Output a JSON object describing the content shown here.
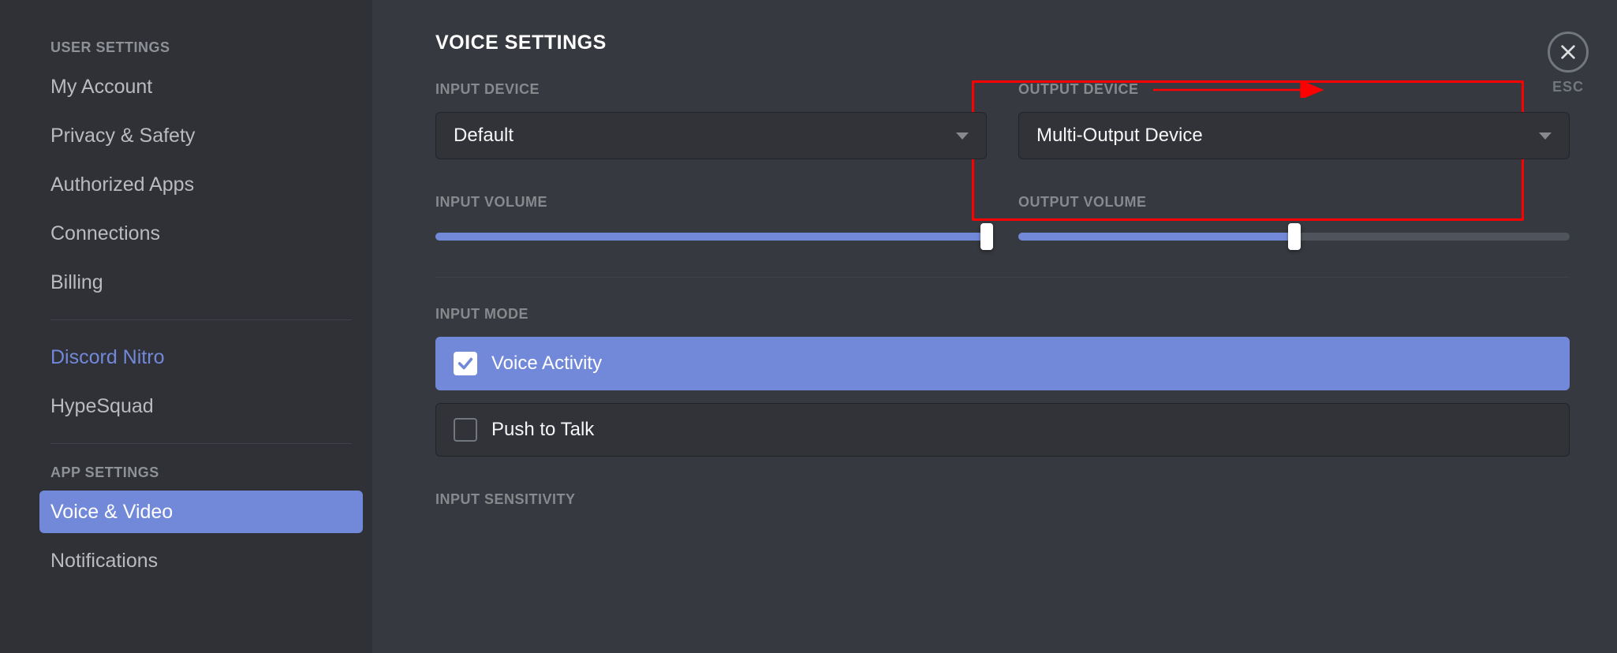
{
  "sidebar": {
    "section_user": "USER SETTINGS",
    "items_user": [
      "My Account",
      "Privacy & Safety",
      "Authorized Apps",
      "Connections",
      "Billing"
    ],
    "item_nitro": "Discord Nitro",
    "item_hypesquad": "HypeSquad",
    "section_app": "APP SETTINGS",
    "item_voice": "Voice & Video",
    "item_notifications": "Notifications"
  },
  "page": {
    "title": "VOICE SETTINGS"
  },
  "input_device": {
    "label": "INPUT DEVICE",
    "value": "Default"
  },
  "output_device": {
    "label": "OUTPUT DEVICE",
    "value": "Multi-Output Device"
  },
  "input_volume": {
    "label": "INPUT VOLUME",
    "percent": 100
  },
  "output_volume": {
    "label": "OUTPUT VOLUME",
    "percent": 50
  },
  "input_mode": {
    "label": "INPUT MODE",
    "voice_activity": "Voice Activity",
    "push_to_talk": "Push to Talk"
  },
  "input_sensitivity": {
    "label": "INPUT SENSITIVITY"
  },
  "close": {
    "label": "ESC"
  }
}
